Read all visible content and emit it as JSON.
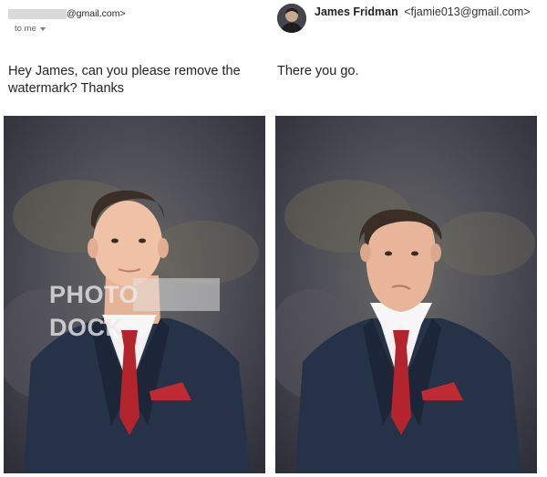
{
  "left": {
    "sender_email": "@gmail.com>",
    "recipient": "to me",
    "message": "Hey James, can you please remove the watermark? Thanks",
    "watermark": "PHOTO DOCK"
  },
  "right": {
    "sender_name": "James Fridman",
    "sender_address": "<fjamie013@gmail.com>",
    "message": "There you go."
  },
  "colors": {
    "suit": "#263247",
    "tie": "#b3242c",
    "backdrop": "#4a4a55"
  }
}
